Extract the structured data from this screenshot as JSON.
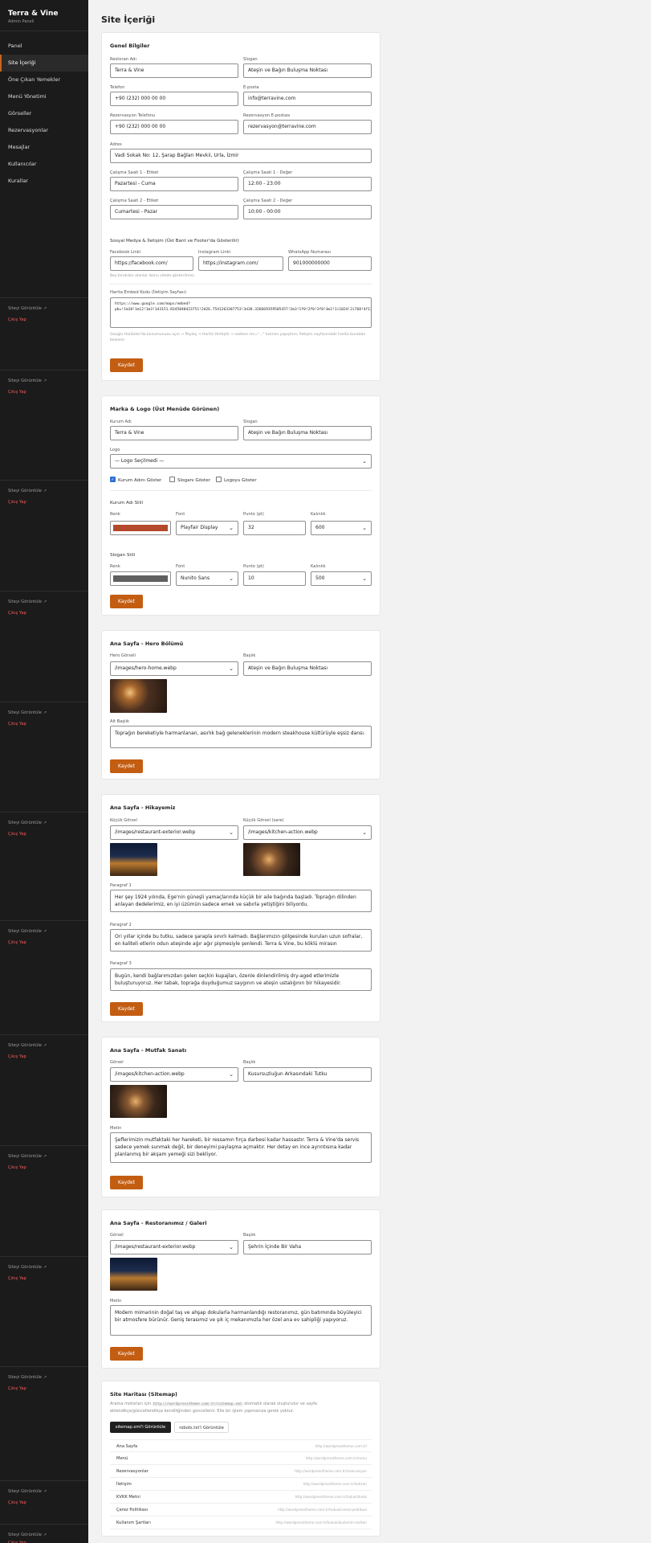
{
  "brand": {
    "title": "Terra & Vine",
    "subtitle": "Admin Paneli"
  },
  "nav": [
    "Panel",
    "Site İçeriği",
    "Öne Çıkan Yemekler",
    "Menü Yönetimi",
    "Görseller",
    "Rezervasyonlar",
    "Mesajlar",
    "Kullanıcılar",
    "Kurallar"
  ],
  "side_links": {
    "view": "Siteyi Görüntüle",
    "logout": "Çıkış Yap"
  },
  "page_title": "Site İçeriği",
  "save_label": "Kaydet",
  "general": {
    "title": "Genel Bilgiler",
    "restaurant_name_label": "Restoran Adı",
    "restaurant_name": "Terra & Vine",
    "slogan_label": "Slogan",
    "slogan": "Ateşin ve Bağın Buluşma Noktası",
    "phone_label": "Telefon",
    "phone": "+90 (232) 000 00 00",
    "email_label": "E-posta",
    "email": "info@terravine.com",
    "res_phone_label": "Rezervasyon Telefonu",
    "res_phone": "+90 (232) 000 00 00",
    "res_email_label": "Rezervasyon E-postası",
    "res_email": "rezervasyon@terravine.com",
    "address_label": "Adres",
    "address": "Vadi Sokak No: 12, Şarap Bağları Mevkii, Urla, İzmir",
    "h1_label_label": "Çalışma Saati 1 - Etiket",
    "h1_label": "Pazartesi - Cuma",
    "h1_value_label": "Çalışma Saati 1 - Değer",
    "h1_value": "12:00 - 23:00",
    "h2_label_label": "Çalışma Saati 2 - Etiket",
    "h2_label": "Cumartesi - Pazar",
    "h2_value_label": "Çalışma Saati 2 - Değer",
    "h2_value": "10:00 - 00:00",
    "social_title": "Sosyal Medya & İletişim (Üst Bant ve Footer'da Gösterilir)",
    "facebook_label": "Facebook Linki",
    "facebook": "https://facebook.com/",
    "instagram_label": "Instagram Linki",
    "instagram": "https://instagram.com/",
    "whatsapp_label": "WhatsApp Numarası",
    "whatsapp": "901000000000",
    "social_hint": "Boş bırakılan alanlar ikonu sitede gösterilmez.",
    "map_label": "Harita Embed Kodu (İletişim Sayfası)",
    "map_code": "https://www.google.com/maps/embed?pb=!1m18!1m12!1m3!1d3151.8345840423751!2d26.7541263307753!3d38.326669359505457!2m3!1f0!2f0!3f0!3m2!1i1024!2i768!4f13.1!3m3!1m2!1s0x14bb94b9e8b6c7bc%3A0x4ae536a68f2c2b8!2sUrla%2C+%C4%B0zmir!5e0!3m2!1str!2str!4v1705887784908!5m2!1str!2str",
    "map_hint": "Google Haritalar'da konumunuzu açın → Paylaş → Harita Yerleştir → sadece src=\"...\" kısmını yapıştırın; İletişim sayfasındaki harita buradan beslenir."
  },
  "brand_logo": {
    "title": "Marka & Logo (Üst Menüde Görünen)",
    "org_label": "Kurum Adı",
    "org": "Terra & Vine",
    "slogan_label": "Slogan",
    "slogan": "Ateşin ve Bağın Buluşma Noktası",
    "logo_label": "Logo",
    "logo": "— Logo Seçilmedi —",
    "chk_name": "Kurum Adını Göster",
    "chk_slogan": "Sloganı Göster",
    "chk_logo": "Logoyu Göster",
    "name_style_title": "Kurum Adı Stili",
    "color_label": "Renk",
    "font_label": "Font",
    "size_label": "Punto (pt)",
    "weight_label": "Kalınlık",
    "name_font": "Playfair Display",
    "name_size": "32",
    "name_weight": "600",
    "slogan_style_title": "Slogan Stili",
    "slogan_font": "Nunito Sans",
    "slogan_size": "10",
    "slogan_weight": "500"
  },
  "hero": {
    "title": "Ana Sayfa - Hero Bölümü",
    "image_label": "Hero Görseli",
    "image": "/images/hero-home.webp",
    "heading_label": "Başlık",
    "heading": "Ateşin ve Bağın Buluşma Noktası",
    "sub_label": "Alt Başlık",
    "sub": "Toprağın bereketiyle harmanlanan, asırlık bağ geleneklerinin modern steakhouse kültürüyle eşsiz dansı."
  },
  "story": {
    "title": "Ana Sayfa - Hikayemiz",
    "small_label": "Küçük Görsel",
    "small": "/images/restaurant-exterior.webp",
    "small2_label": "Küçük Görsel (sare)",
    "small2": "/images/kitchen-action.webp",
    "p1_label": "Paragraf 1",
    "p1": "Her şey 1924 yılında, Ege'nin güneşli yamaçlarında küçük bir aile bağında başladı. Toprağın dilinden anlayan dedelerimiz, en iyi üzümün sadece emek ve sabırla yetiştiğini biliyordu.",
    "p2_label": "Paragraf 2",
    "p2": "Ori yıllar içinde bu tutku, sadece şarapla sınırlı kalmadı. Bağlarımızın gölgesinde kurulan uzun sofralar, en kaliteli etlerin odun ateşinde ağır ağır pişmesiyle şenlendi. Terra & Vine, bu köklü mirasın",
    "p3_label": "Paragraf 3",
    "p3": "Bugün, kendi bağlarımızdan gelen seçkin kupajları, özenle dinlendirilmiş dry-aged etlerimizle buluşturuyoruz. Her tabak, toprağa duyduğumuz saygının ve ateşin ustalığının bir hikayesidir."
  },
  "kitchen": {
    "title": "Ana Sayfa - Mutfak Sanatı",
    "image_label": "Görsel",
    "image": "/images/kitchen-action.webp",
    "heading_label": "Başlık",
    "heading": "Kusursuzluğun Arkasındaki Tutku",
    "text_label": "Metin",
    "text": "Şeflerimizin mutfaktaki her hareketi, bir ressamın fırça darbesi kadar hassastır. Terra & Vine'da servis sadece yemek sunmak değil, bir deneyimi paylaşma açmaktır. Her detay en ince ayrıntısına kadar planlanmış bir akşam yemeği sizi bekliyor."
  },
  "gallery": {
    "title": "Ana Sayfa - Restoranımız / Galeri",
    "image_label": "Görsel",
    "image": "/images/restaurant-exterior.webp",
    "heading_label": "Başlık",
    "heading": "Şehrin İçinde Bir Vaha",
    "text_label": "Metin",
    "text": "Modern mimarinin doğal taş ve ahşap dokularla harmanlandığı restoranımız, gün batımında büyüleyici bir atmosfere bürünür. Geniş terasımız ve şık iç mekanımızla her özel ana ev sahipliği yapıyoruz."
  },
  "sitemap": {
    "title": "Site Haritası (Sitemap)",
    "desc_a": "Arama motorları için",
    "desc_code": "http://wordpresstheme.com.tr/sitemap.xml",
    "desc_b": "otomatik olarak oluşturulur ve sayfa eklendikçe/güncellendikçe kendiliğinden güncellenir. Elle bir işlem yapmanıza gerek yoktur.",
    "btn_xml": "sitemap.xml'i Görüntüle",
    "btn_robots": "robots.txt'i Görüntüle",
    "rows": [
      {
        "name": "Ana Sayfa",
        "url": "http://wordpresstheme.com.tr/"
      },
      {
        "name": "Menü",
        "url": "http://wordpresstheme.com.tr/menu"
      },
      {
        "name": "Rezervasyonlar",
        "url": "http://wordpresstheme.com.tr/rezervasyon"
      },
      {
        "name": "İletişim",
        "url": "http://wordpresstheme.com.tr/iletisim"
      },
      {
        "name": "KVKK Metni",
        "url": "http://wordpresstheme.com.tr/hukuki/kvkk"
      },
      {
        "name": "Çerez Politikası",
        "url": "http://wordpresstheme.com.tr/hukuki/cerez-politikasi"
      },
      {
        "name": "Kullanım Şartları",
        "url": "http://wordpresstheme.com.tr/hukuki/kullanim-sartlari"
      }
    ]
  },
  "colors": {
    "accent": "#c25d12",
    "name_color": "#b5472a",
    "slogan_color": "#5f5f5f",
    "sidebar": "#1b1b1b"
  }
}
